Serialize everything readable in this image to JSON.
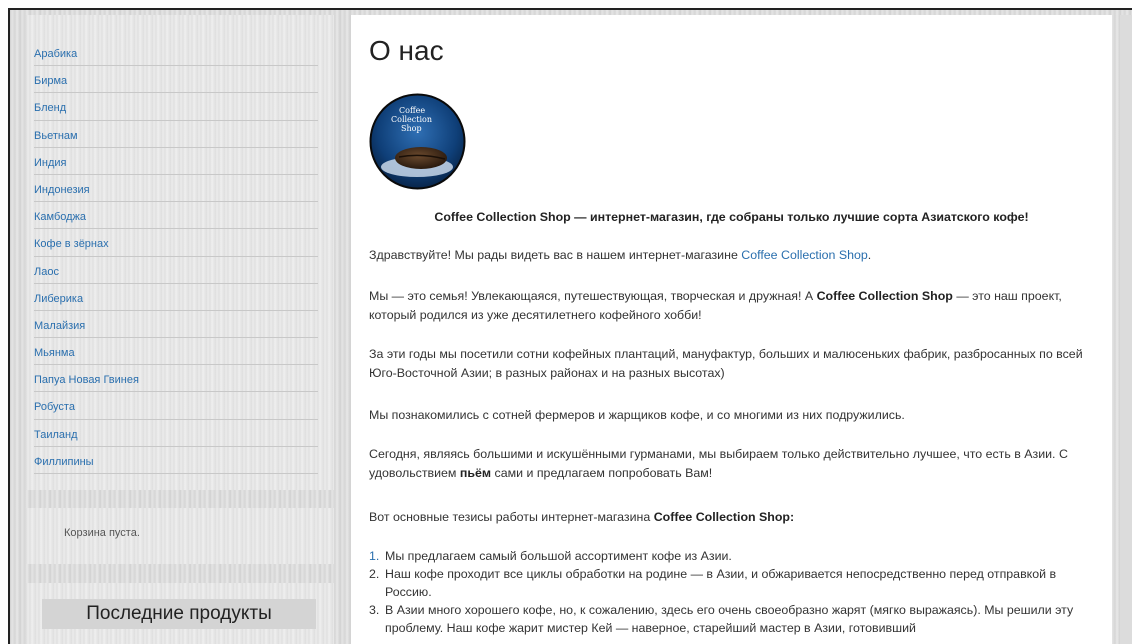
{
  "sidebar": {
    "menu": [
      "Арабика",
      "Бирма",
      "Бленд",
      "Вьетнам",
      "Индия",
      "Индонезия",
      "Камбоджа",
      "Кофе в зёрнах",
      "Лаос",
      "Либерика",
      "Малайзия",
      "Мьянма",
      "Папуа Новая Гвинея",
      "Робуста",
      "Таиланд",
      "Филлипины"
    ],
    "cart_text": "Корзина пуста.",
    "recent_title": "Последние продукты"
  },
  "main": {
    "title": "О нас",
    "logo": {
      "line1": "Coffee",
      "line2": "Collection",
      "line3": "Shop"
    },
    "tagline": "Coffee Collection Shop — интернет-магазин, где собраны только лучшие сорта Азиатского кофе!",
    "greeting_prefix": "Здравствуйте! Мы рады видеть вас в нашем интернет-магазине ",
    "greeting_link": "Coffee Collection Shop",
    "greeting_suffix": ".",
    "family_prefix": "Мы — это семья! Увлекающаяся, путешествующая, творческая и дружная! А ",
    "family_bold": "Coffee Collection Shop",
    "family_suffix": " — это наш проект, который родился из уже десятилетнего кофейного хобби!",
    "years": "За эти годы мы посетили сотни кофейных плантаций, мануфактур, больших и малюсеньких фабрик, разбросанных по всей Юго-Восточной Азии; в разных районах и на разных высотах)",
    "farmers": "Мы познакомились с сотней фермеров и жарщиков кофе, и со многими из них подружились.",
    "today_prefix": "Сегодня, являясь большими и искушёнными гурманами, мы выбираем только действительно лучшее, что есть в Азии. С удовольствием ",
    "today_bold": "пьём",
    "today_suffix": " сами и предлагаем попробовать Вам!",
    "theses_prefix": "Вот основные тезисы работы интернет-магазина ",
    "theses_bold": "Coffee Collection Shop:",
    "list": [
      {
        "num": "1.",
        "text": "Мы предлагаем самый большой ассортимент кофе из Азии."
      },
      {
        "num": "2.",
        "text": "Наш кофе проходит все циклы обработки на родине — в Азии, и обжаривается непосредственно перед отправкой в Россию."
      },
      {
        "num": "3.",
        "text": "В Азии много хорошего кофе, но, к сожалению, здесь его очень своеобразно жарят (мягко выражаясь). Мы решили эту проблему. Наш кофе жарит мистер Кей — наверное, старейший мастер в Азии, готовивший"
      }
    ]
  },
  "colors": {
    "link": "#2a6fae",
    "text": "#333333"
  }
}
